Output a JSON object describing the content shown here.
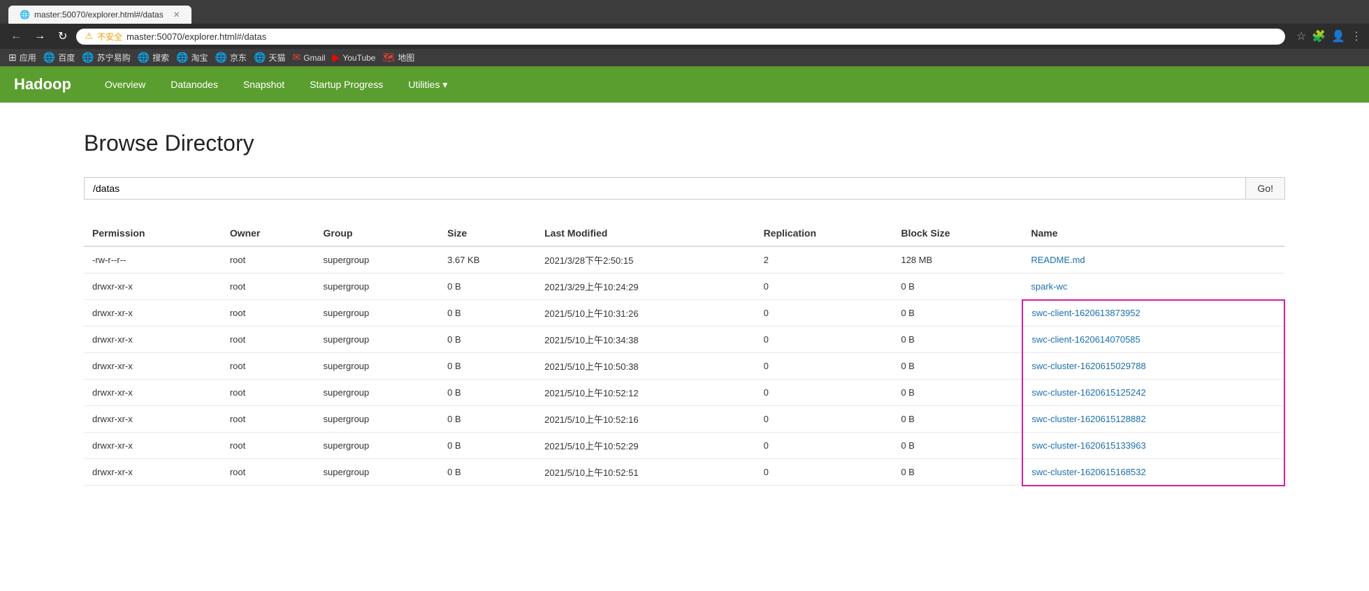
{
  "browser": {
    "tab_title": "master:50070/explorer.html#/datas",
    "address": "master:50070/explorer.html#/datas",
    "warning_text": "不安全",
    "bookmarks": [
      {
        "label": "应用",
        "icon": "⊞"
      },
      {
        "label": "百度",
        "icon": "🌐"
      },
      {
        "label": "苏宁易购",
        "icon": "🌐"
      },
      {
        "label": "搜索",
        "icon": "🌐"
      },
      {
        "label": "淘宝",
        "icon": "🌐"
      },
      {
        "label": "京东",
        "icon": "🌐"
      },
      {
        "label": "天猫",
        "icon": "🌐"
      },
      {
        "label": "Gmail",
        "icon": "✉"
      },
      {
        "label": "YouTube",
        "icon": "▶"
      },
      {
        "label": "地图",
        "icon": "🗺"
      }
    ]
  },
  "hadoop": {
    "logo": "Hadoop",
    "nav": [
      {
        "label": "Overview"
      },
      {
        "label": "Datanodes"
      },
      {
        "label": "Snapshot"
      },
      {
        "label": "Startup Progress"
      },
      {
        "label": "Utilities",
        "dropdown": true
      }
    ]
  },
  "page": {
    "title": "Browse Directory",
    "path_value": "/datas",
    "path_placeholder": "/datas",
    "go_label": "Go!"
  },
  "table": {
    "columns": [
      "Permission",
      "Owner",
      "Group",
      "Size",
      "Last Modified",
      "Replication",
      "Block Size",
      "Name"
    ],
    "rows": [
      {
        "permission": "-rw-r--r--",
        "owner": "root",
        "group": "supergroup",
        "size": "3.67 KB",
        "last_modified": "2021/3/28下午2:50:15",
        "replication": "2",
        "block_size": "128 MB",
        "name": "README.md",
        "highlighted": false
      },
      {
        "permission": "drwxr-xr-x",
        "owner": "root",
        "group": "supergroup",
        "size": "0 B",
        "last_modified": "2021/3/29上午10:24:29",
        "replication": "0",
        "block_size": "0 B",
        "name": "spark-wc",
        "highlighted": false
      },
      {
        "permission": "drwxr-xr-x",
        "owner": "root",
        "group": "supergroup",
        "size": "0 B",
        "last_modified": "2021/5/10上午10:31:26",
        "replication": "0",
        "block_size": "0 B",
        "name": "swc-client-1620613873952",
        "highlighted": true
      },
      {
        "permission": "drwxr-xr-x",
        "owner": "root",
        "group": "supergroup",
        "size": "0 B",
        "last_modified": "2021/5/10上午10:34:38",
        "replication": "0",
        "block_size": "0 B",
        "name": "swc-client-1620614070585",
        "highlighted": true
      },
      {
        "permission": "drwxr-xr-x",
        "owner": "root",
        "group": "supergroup",
        "size": "0 B",
        "last_modified": "2021/5/10上午10:50:38",
        "replication": "0",
        "block_size": "0 B",
        "name": "swc-cluster-1620615029788",
        "highlighted": true
      },
      {
        "permission": "drwxr-xr-x",
        "owner": "root",
        "group": "supergroup",
        "size": "0 B",
        "last_modified": "2021/5/10上午10:52:12",
        "replication": "0",
        "block_size": "0 B",
        "name": "swc-cluster-1620615125242",
        "highlighted": true
      },
      {
        "permission": "drwxr-xr-x",
        "owner": "root",
        "group": "supergroup",
        "size": "0 B",
        "last_modified": "2021/5/10上午10:52:16",
        "replication": "0",
        "block_size": "0 B",
        "name": "swc-cluster-1620615128882",
        "highlighted": true
      },
      {
        "permission": "drwxr-xr-x",
        "owner": "root",
        "group": "supergroup",
        "size": "0 B",
        "last_modified": "2021/5/10上午10:52:29",
        "replication": "0",
        "block_size": "0 B",
        "name": "swc-cluster-1620615133963",
        "highlighted": true
      },
      {
        "permission": "drwxr-xr-x",
        "owner": "root",
        "group": "supergroup",
        "size": "0 B",
        "last_modified": "2021/5/10上午10:52:51",
        "replication": "0",
        "block_size": "0 B",
        "name": "swc-cluster-1620615168532",
        "highlighted": true
      }
    ]
  }
}
